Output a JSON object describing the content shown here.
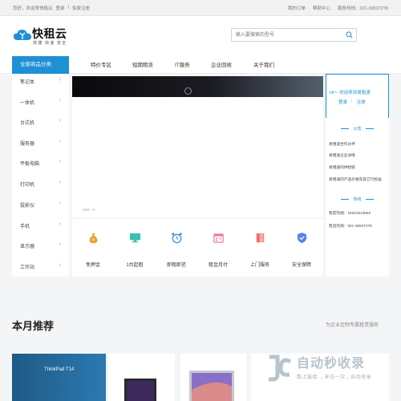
{
  "topbar": {
    "greeting": "您好，欢迎来快租云",
    "login": "登录",
    "sep": "|",
    "register": "免费注册",
    "my_orders": "我的订单",
    "help": "帮助中心",
    "hotline": "服务热线：021-36537278"
  },
  "header": {
    "logo_name": "快租云",
    "logo_tagline": "简捷 快速 安全",
    "search_placeholder": "输入要搜索的型号"
  },
  "nav": {
    "category_tab": "全部商品分类",
    "links": [
      "特价专区",
      "短期租赁",
      "IT服务",
      "企业回收",
      "关于我们"
    ]
  },
  "sidebar": {
    "items": [
      "笔记本",
      "一体机",
      "台式机",
      "服务器",
      "平板电脑",
      "打印机",
      "投影仪",
      "手机",
      "显示器",
      "工作站"
    ]
  },
  "features": [
    "免押金",
    "1台起租",
    "即租即还",
    "租金月付",
    "上门服务",
    "安全保障"
  ],
  "panel": {
    "welcome": "Hi～ 欢迎来到易租速",
    "login": "登录",
    "register": "注册",
    "sep": "|",
    "notice_title": "公告",
    "notices": [
      "易租速合作伙伴",
      "易租速企业详情",
      "易租速的供给链",
      "易租速的产品价格及其它行标准"
    ],
    "hotline_title": "热线",
    "hotlines": [
      "售前热线：15221613562",
      "售后热线：021-36537278"
    ]
  },
  "month": {
    "title": "本月推荐",
    "subtitle": "为企业定制专属租赁服务"
  },
  "cards": {
    "thinkpad": "ThinkPad T14"
  },
  "watermark": {
    "big": "自动秒收录",
    "small": "数上链接 →来访一次→自动收录"
  },
  "colors": {
    "accent": "#1f8fd6",
    "feature_icon": "#f0a030"
  }
}
